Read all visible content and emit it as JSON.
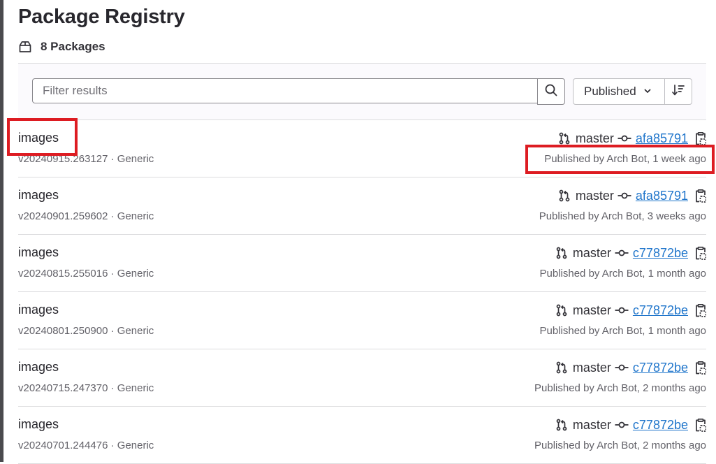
{
  "page": {
    "title": "Package Registry",
    "package_count": "8 Packages"
  },
  "filter": {
    "placeholder": "Filter results",
    "sort_label": "Published"
  },
  "packages": [
    {
      "name": "images",
      "meta": "v20240915.263127 · Generic",
      "branch": "master",
      "commit": "afa85791",
      "published": "Published by Arch Bot, 1 week ago"
    },
    {
      "name": "images",
      "meta": "v20240901.259602 · Generic",
      "branch": "master",
      "commit": "afa85791",
      "published": "Published by Arch Bot, 3 weeks ago"
    },
    {
      "name": "images",
      "meta": "v20240815.255016 · Generic",
      "branch": "master",
      "commit": "c77872be",
      "published": "Published by Arch Bot, 1 month ago"
    },
    {
      "name": "images",
      "meta": "v20240801.250900 · Generic",
      "branch": "master",
      "commit": "c77872be",
      "published": "Published by Arch Bot, 1 month ago"
    },
    {
      "name": "images",
      "meta": "v20240715.247370 · Generic",
      "branch": "master",
      "commit": "c77872be",
      "published": "Published by Arch Bot, 2 months ago"
    },
    {
      "name": "images",
      "meta": "v20240701.244476 · Generic",
      "branch": "master",
      "commit": "c77872be",
      "published": "Published by Arch Bot, 2 months ago"
    }
  ],
  "icons": {
    "package": "package-icon",
    "search": "search-icon",
    "chevron": "chevron-down-icon",
    "sort": "sort-direction-icon",
    "branch": "merge-request-branch-icon",
    "commit": "commit-icon",
    "copy": "copy-to-clipboard-icon"
  },
  "colors": {
    "link": "#1f75cb",
    "highlight": "#dd1c22",
    "text": "#333238",
    "muted": "#626168"
  }
}
